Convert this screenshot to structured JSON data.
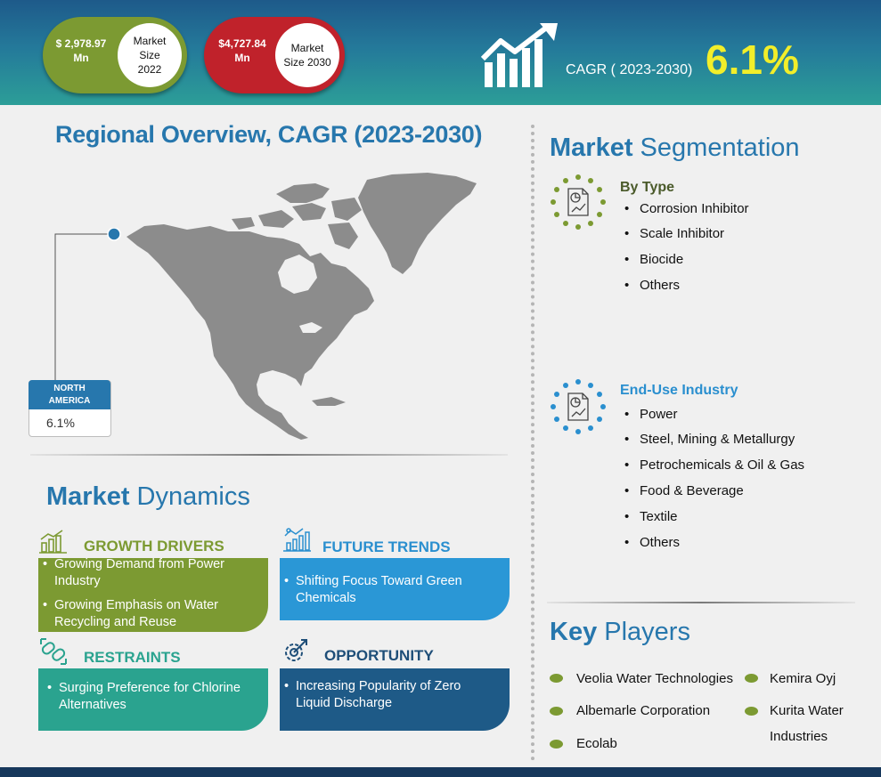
{
  "header": {
    "market_2022": {
      "value": "$ 2,978.97 Mn",
      "label": "Market Size 2022"
    },
    "market_2030": {
      "value": "$4,727.84 Mn",
      "label": "Market Size 2030"
    },
    "cagr_label": "CAGR ( 2023-2030)",
    "cagr_value": "6.1%",
    "colors": {
      "header_top": "#1e5a8a",
      "header_bottom": "#2c9e98",
      "green": "#7c9a32",
      "red": "#c0222b",
      "cagr": "#f2ee2a"
    }
  },
  "regional": {
    "title": "Regional Overview, CAGR (2023-2030)",
    "region_name": "NORTH AMERICA",
    "region_cagr": "6.1%"
  },
  "segmentation": {
    "title_bold": "Market",
    "title_rest": " Segmentation",
    "by_type": {
      "heading": "By Type",
      "icon": "report-icon",
      "items": [
        "Corrosion Inhibitor",
        "Scale Inhibitor",
        "Biocide",
        "Others"
      ]
    },
    "end_use": {
      "heading": "End-Use Industry",
      "icon": "report-icon",
      "items": [
        "Power",
        "Steel, Mining & Metallurgy",
        "Petrochemicals  & Oil & Gas",
        "Food & Beverage",
        "Textile",
        "Others"
      ]
    }
  },
  "dynamics": {
    "title_bold": "Market",
    "title_rest": " Dynamics",
    "growth_drivers": {
      "heading": "GROWTH DRIVERS",
      "icon": "bar-chart-icon",
      "items": [
        "Growing Demand from Power Industry",
        "Growing Emphasis on Water Recycling and Reuse"
      ]
    },
    "future_trends": {
      "heading": "FUTURE TRENDS",
      "icon": "trend-chart-icon",
      "items": [
        "Shifting Focus Toward Green Chemicals"
      ]
    },
    "restraints": {
      "heading": "RESTRAINTS",
      "icon": "chain-link-icon",
      "items": [
        "Surging Preference  for Chlorine Alternatives"
      ]
    },
    "opportunity": {
      "heading": "OPPORTUNITY",
      "icon": "gear-target-icon",
      "items": [
        "Increasing Popularity of Zero Liquid Discharge"
      ]
    }
  },
  "key_players": {
    "title_bold": "Key",
    "title_rest": " Players",
    "left": [
      "Veolia Water Technologies",
      "Albemarle Corporation",
      "Ecolab"
    ],
    "right": [
      "Kemira Oyj",
      "Kurita Water Industries"
    ]
  }
}
